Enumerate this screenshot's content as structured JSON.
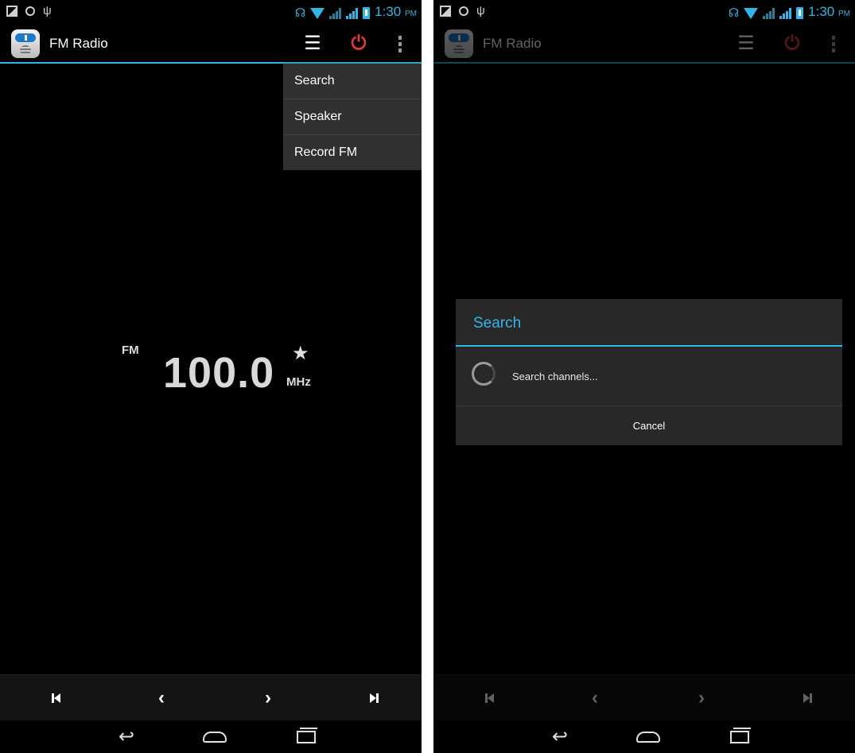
{
  "status_bar": {
    "left_icons": [
      "gallery-icon",
      "circle-icon",
      "usb-icon"
    ],
    "right_icons": [
      "headset-icon",
      "wifi-icon",
      "signal-icon",
      "signal-icon",
      "battery-icon"
    ],
    "time": "1:30",
    "ampm": "PM"
  },
  "action_bar": {
    "title": "FM Radio",
    "actions": [
      "channel-list-icon",
      "power-icon",
      "overflow-menu-icon"
    ],
    "accent_color": "#33b5e5",
    "power_color": "#e53935"
  },
  "overflow_menu": {
    "items": [
      "Search",
      "Speaker",
      "Record FM"
    ]
  },
  "tuner": {
    "band": "FM",
    "frequency": "100.0",
    "unit": "MHz",
    "favorite_icon": "star-icon"
  },
  "controls": [
    "prev-station-icon",
    "tune-down-icon",
    "tune-up-icon",
    "next-station-icon"
  ],
  "navigation": [
    "back-icon",
    "home-icon",
    "recent-apps-icon"
  ],
  "search_dialog": {
    "title": "Search",
    "message": "Search channels...",
    "cancel_label": "Cancel"
  }
}
